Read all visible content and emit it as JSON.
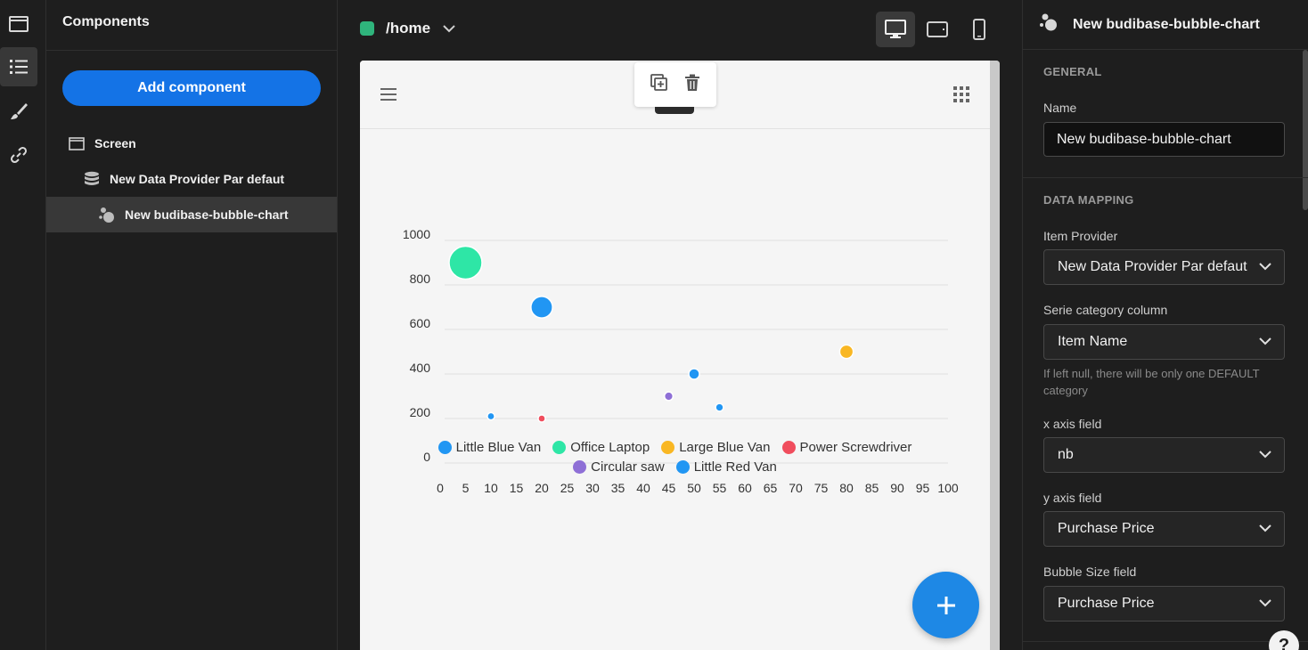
{
  "components_panel": {
    "title": "Components",
    "add_button": "Add component",
    "tree": [
      {
        "label": "Screen",
        "icon": "screen-icon"
      },
      {
        "label": "New Data Provider Par defaut",
        "icon": "database-icon"
      },
      {
        "label": "New budibase-bubble-chart",
        "icon": "bubble-chart-icon"
      }
    ]
  },
  "canvas": {
    "route": "/home",
    "route_color": "#2fb47c",
    "devices": [
      "desktop",
      "tablet",
      "mobile"
    ],
    "active_device": "desktop"
  },
  "chart_data": {
    "type": "scatter",
    "subtype": "bubble",
    "xlim": [
      0,
      100
    ],
    "ylim": [
      0,
      1000
    ],
    "x_ticks": [
      0,
      5,
      10,
      15,
      20,
      25,
      30,
      35,
      40,
      45,
      50,
      55,
      60,
      65,
      70,
      75,
      80,
      85,
      90,
      95,
      100
    ],
    "y_ticks": [
      0,
      200,
      400,
      600,
      800,
      1000
    ],
    "grid": "horizontal",
    "legend_position": "bottom",
    "series": [
      {
        "name": "Little Blue Van",
        "color": "#2196f3",
        "points": [
          {
            "x": 10,
            "y": 210,
            "size": 210
          },
          {
            "x": 20,
            "y": 700,
            "size": 700
          }
        ]
      },
      {
        "name": "Office Laptop",
        "color": "#2ee6a6",
        "points": [
          {
            "x": 5,
            "y": 900,
            "size": 900
          }
        ]
      },
      {
        "name": "Large Blue Van",
        "color": "#f9b723",
        "points": [
          {
            "x": 80,
            "y": 500,
            "size": 500
          }
        ]
      },
      {
        "name": "Power Screwdriver",
        "color": "#f04d5d",
        "points": [
          {
            "x": 20,
            "y": 200,
            "size": 200
          }
        ]
      },
      {
        "name": "Circular saw",
        "color": "#8e6fd6",
        "points": [
          {
            "x": 45,
            "y": 300,
            "size": 300
          }
        ]
      },
      {
        "name": "Little Red Van",
        "color": "#2196f3",
        "points": [
          {
            "x": 50,
            "y": 400,
            "size": 400
          },
          {
            "x": 55,
            "y": 250,
            "size": 250
          }
        ]
      }
    ]
  },
  "settings": {
    "title": "New budibase-bubble-chart",
    "general_label": "GENERAL",
    "name_label": "Name",
    "name_value": "New budibase-bubble-chart",
    "data_mapping_label": "DATA MAPPING",
    "item_provider_label": "Item Provider",
    "item_provider_value": "New Data Provider Par defaut",
    "serie_category_label": "Serie category column",
    "serie_category_value": "Item Name",
    "serie_helper": "If left null, there will be only one DEFAULT category",
    "x_axis_label": "x axis field",
    "x_axis_value": "nb",
    "y_axis_label": "y axis field",
    "y_axis_value": "Purchase Price",
    "bubble_size_label": "Bubble Size field",
    "bubble_size_value": "Purchase Price",
    "help": "?"
  }
}
